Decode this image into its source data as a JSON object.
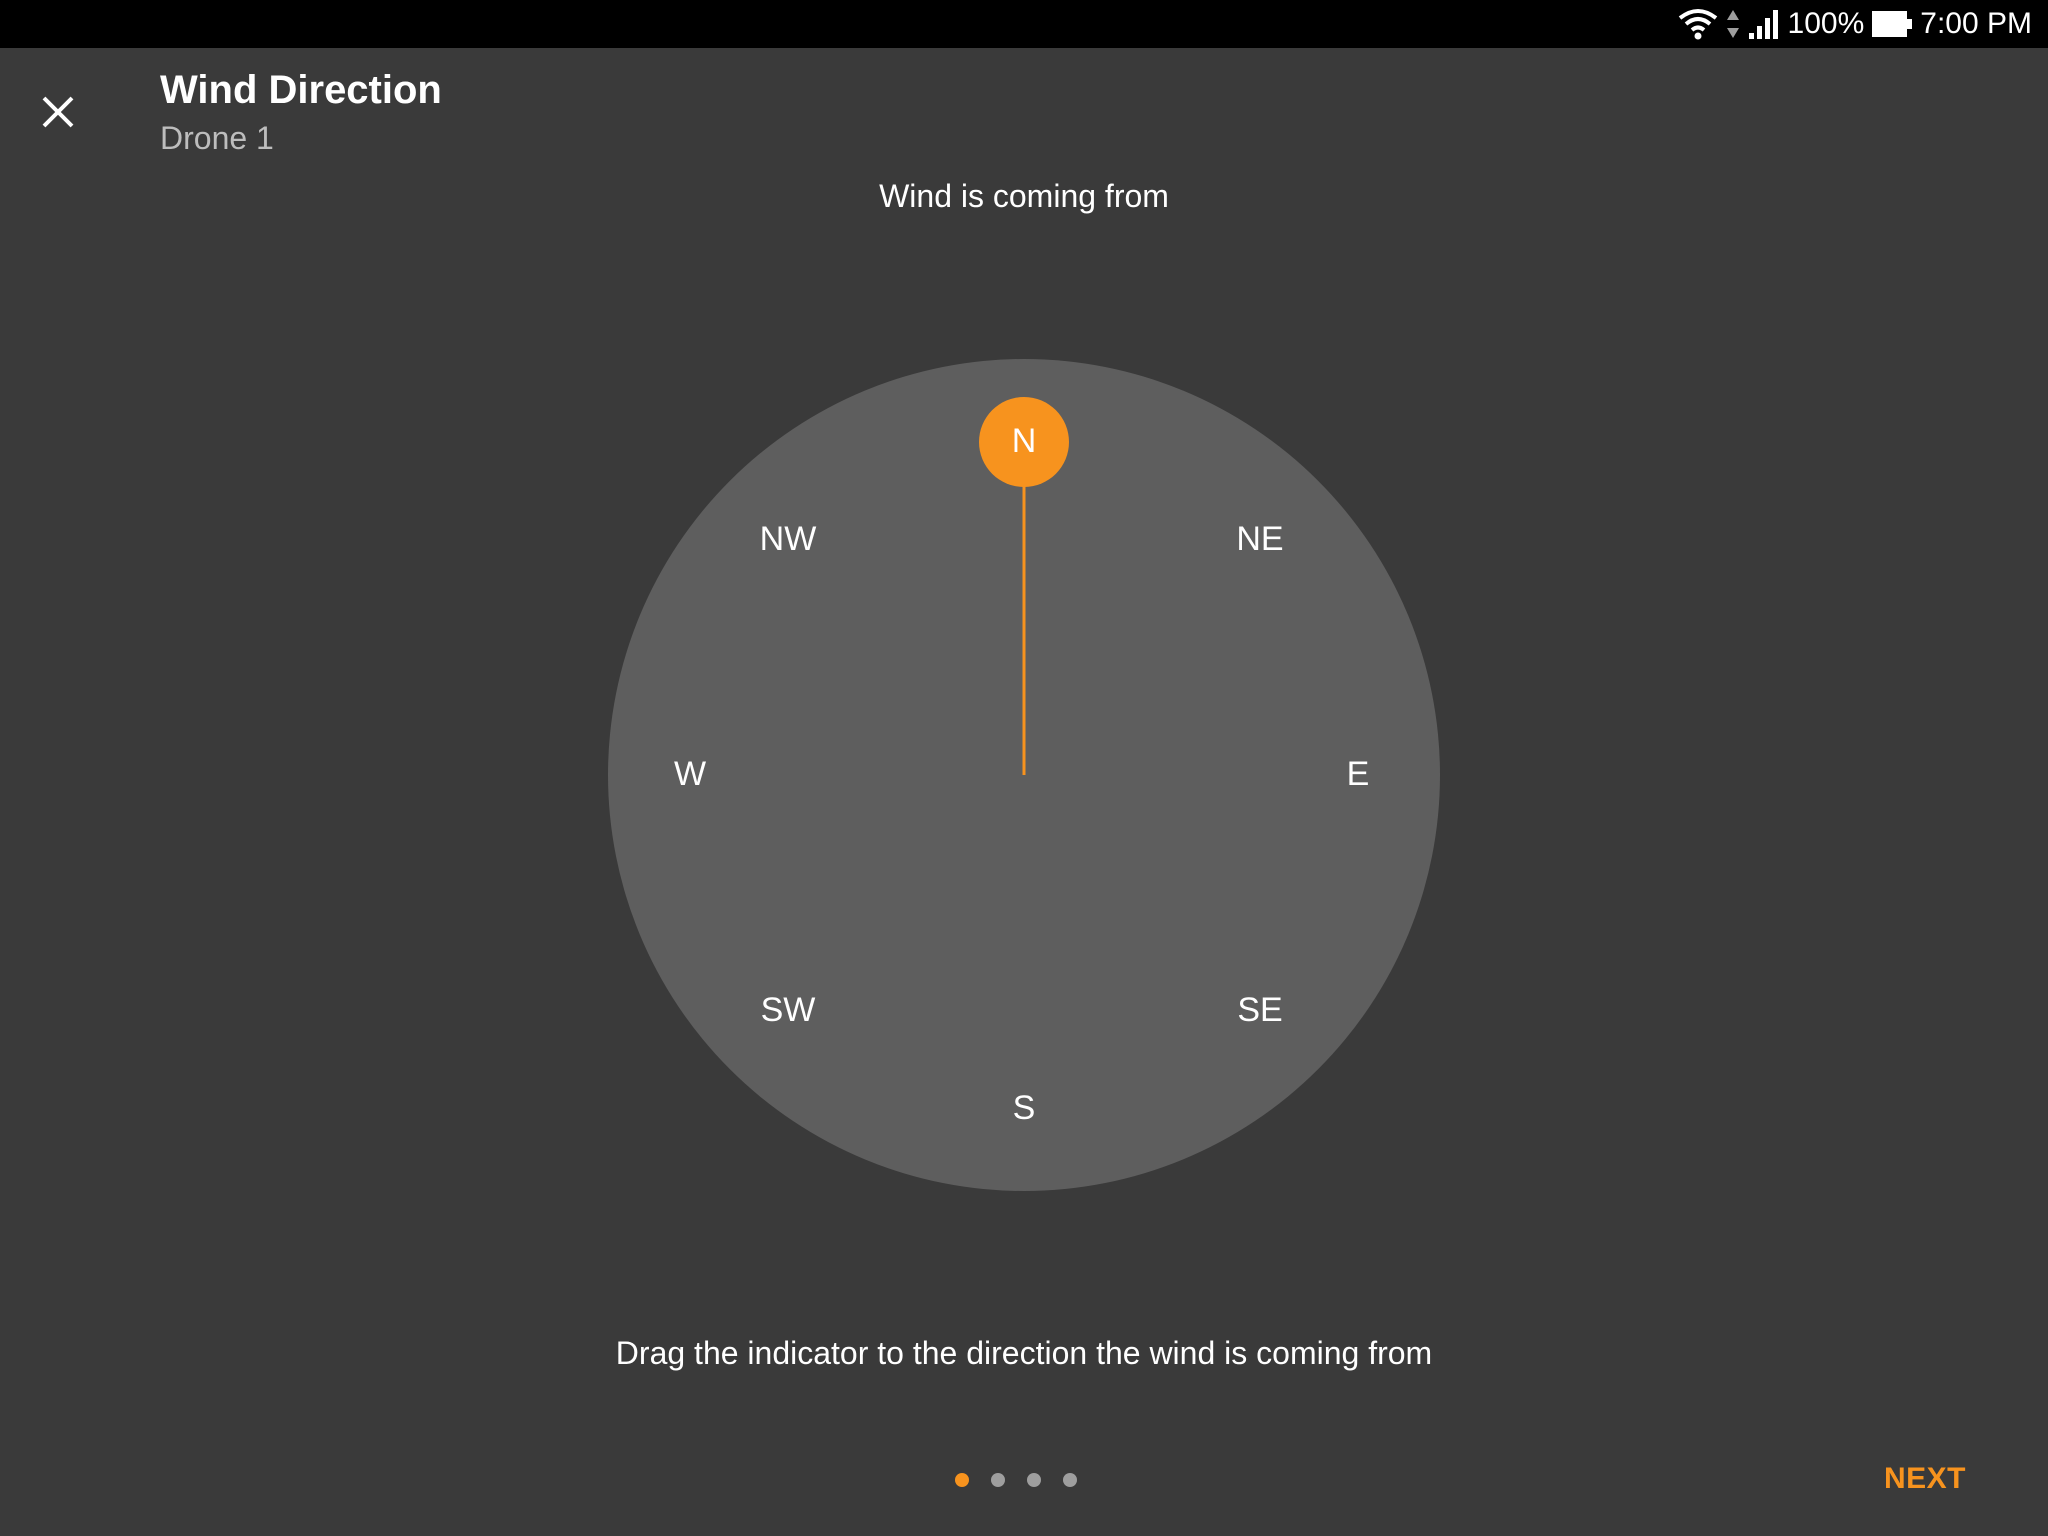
{
  "status_bar": {
    "battery": "100%",
    "time": "7:00 PM",
    "icons": [
      "wifi-icon",
      "data-arrows-icon",
      "signal-icon",
      "battery-icon"
    ]
  },
  "header": {
    "close_icon": "close-icon",
    "title": "Wind Direction",
    "subtitle": "Drone 1"
  },
  "prompt": "Wind is coming from",
  "compass": {
    "selected": "N",
    "labels": {
      "N": "N",
      "NE": "NE",
      "E": "E",
      "SE": "SE",
      "S": "S",
      "SW": "SW",
      "W": "W",
      "NW": "NW"
    }
  },
  "instruction": "Drag the indicator to the direction the wind is coming from",
  "pager": {
    "count": 4,
    "active_index": 0
  },
  "footer": {
    "next_label": "NEXT"
  },
  "colors": {
    "accent": "#f7931e",
    "background": "#3a3a3a",
    "compass_fill": "#5e5e5e",
    "status_bar": "#000000"
  }
}
